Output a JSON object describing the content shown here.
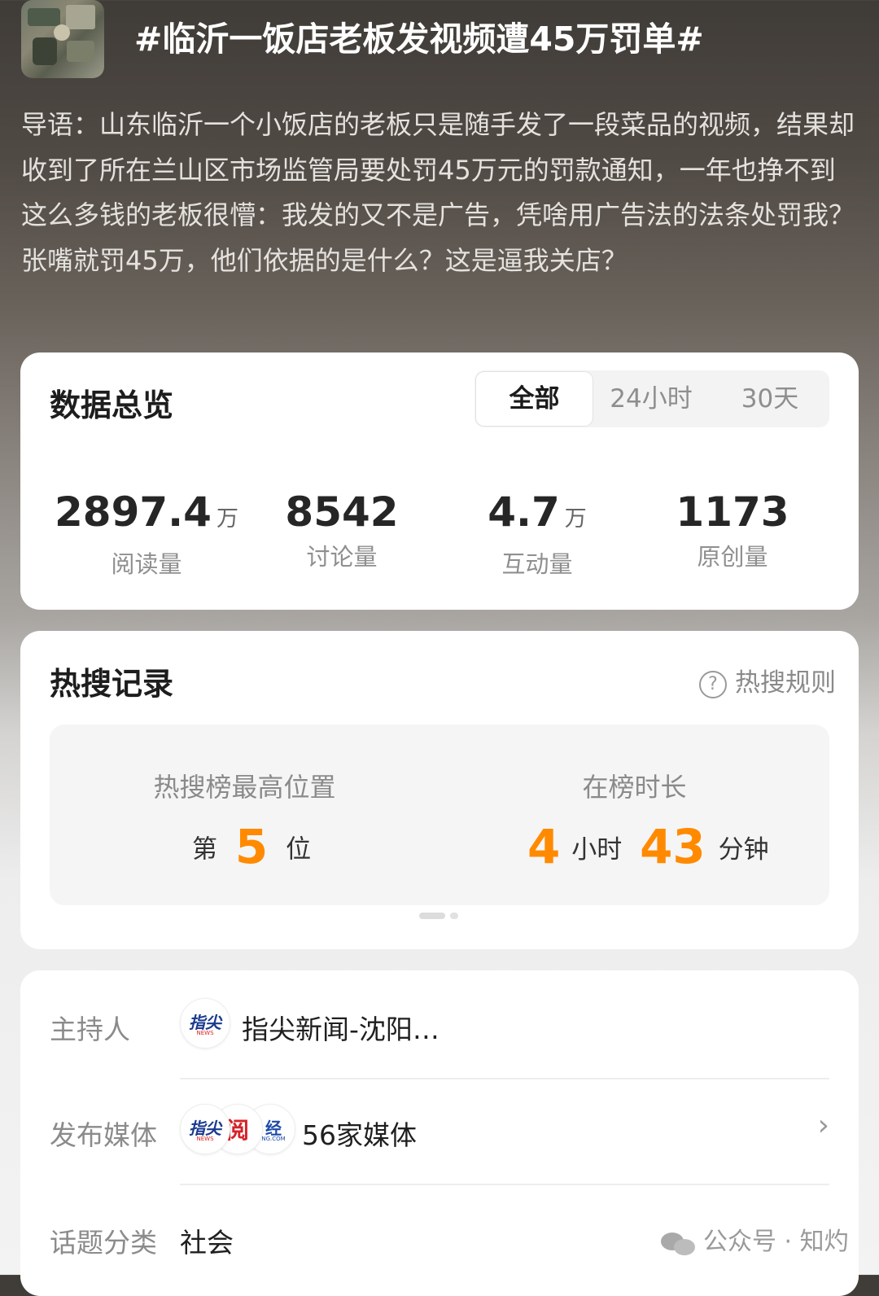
{
  "header": {
    "title": "#临沂一饭店老板发视频遭45万罚单#",
    "intro": "导语：山东临沂一个小饭店的老板只是随手发了一段菜品的视频，结果却收到了所在兰山区市场监管局要处罚45万元的罚款通知，一年也挣不到这么多钱的老板很懵：我发的又不是广告，凭啥用广告法的法条处罚我？张嘴就罚45万，他们依据的是什么？这是逼我关店？"
  },
  "overview": {
    "title": "数据总览",
    "tabs": [
      {
        "label": "全部",
        "active": true
      },
      {
        "label": "24小时",
        "active": false
      },
      {
        "label": "30天",
        "active": false
      }
    ],
    "stats": [
      {
        "value": "2897.4",
        "unit": "万",
        "label": "阅读量"
      },
      {
        "value": "8542",
        "unit": "",
        "label": "讨论量"
      },
      {
        "value": "4.7",
        "unit": "万",
        "label": "互动量"
      },
      {
        "value": "1173",
        "unit": "",
        "label": "原创量"
      }
    ]
  },
  "hot_search": {
    "title": "热搜记录",
    "rules_label": "热搜规则",
    "rules_icon": "question-circle-icon",
    "peak": {
      "label": "热搜榜最高位置",
      "prefix": "第",
      "value": "5",
      "suffix": "位"
    },
    "duration": {
      "label": "在榜时长",
      "hours": "4",
      "hours_unit": "小时",
      "minutes": "43",
      "minutes_unit": "分钟"
    },
    "accent_color": "#ff8a00",
    "pager": {
      "pages": 2,
      "current": 1
    }
  },
  "info": {
    "host": {
      "label": "主持人",
      "value": "指尖新闻-沈阳…",
      "logo": {
        "text": "指尖",
        "sub": "NEWS"
      }
    },
    "media": {
      "label": "发布媒体",
      "value": "56家媒体",
      "logos": [
        {
          "text": "指尖",
          "sub": "NEWS"
        },
        {
          "text": "阅",
          "sub": ""
        },
        {
          "text": "经",
          "sub": "NG.COM"
        }
      ]
    },
    "category": {
      "label": "话题分类",
      "value": "社会"
    }
  },
  "watermark": {
    "text": "公众号 · 知灼",
    "icon": "wechat-icon"
  }
}
